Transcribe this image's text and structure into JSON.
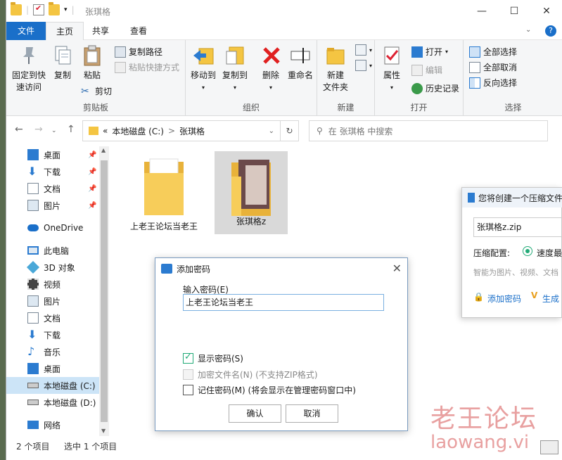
{
  "window": {
    "title": "张琪格",
    "minimize": "—",
    "maximize": "☐",
    "close": "✕"
  },
  "tabs": [
    "文件",
    "主页",
    "共享",
    "查看"
  ],
  "help_icon": "?",
  "ribbon": {
    "clipboard": {
      "pin_label": "固定到快速访问",
      "copy_label": "复制",
      "paste_label": "粘贴",
      "copy_path": "复制路径",
      "paste_shortcut": "粘贴快捷方式",
      "cut": "剪切",
      "group": "剪贴板"
    },
    "organize": {
      "move_to": "移动到",
      "copy_to": "复制到",
      "delete": "删除",
      "rename": "重命名",
      "group": "组织"
    },
    "new": {
      "new_folder": "新建\n文件夹",
      "group": "新建"
    },
    "open": {
      "properties": "属性",
      "open": "打开",
      "edit": "编辑",
      "history": "历史记录",
      "group": "打开"
    },
    "select": {
      "select_all": "全部选择",
      "select_none": "全部取消",
      "invert": "反向选择",
      "group": "选择"
    }
  },
  "address": {
    "prefix": "«",
    "drive": "本地磁盘 (C:)",
    "sep": ">",
    "folder": "张琪格",
    "search_placeholder": "在 张琪格 中搜索"
  },
  "nav": {
    "items": [
      {
        "label": "桌面",
        "pinned": true
      },
      {
        "label": "下载",
        "pinned": true
      },
      {
        "label": "文档",
        "pinned": true
      },
      {
        "label": "图片",
        "pinned": true
      },
      {
        "label": "OneDrive"
      },
      {
        "label": "此电脑"
      },
      {
        "label": "3D 对象"
      },
      {
        "label": "视频"
      },
      {
        "label": "图片"
      },
      {
        "label": "文档"
      },
      {
        "label": "下载"
      },
      {
        "label": "音乐"
      },
      {
        "label": "桌面"
      },
      {
        "label": "本地磁盘 (C:)"
      },
      {
        "label": "本地磁盘 (D:)"
      },
      {
        "label": "网络"
      }
    ]
  },
  "files": [
    {
      "name": "上老王论坛当老王"
    },
    {
      "name": "张琪格z"
    }
  ],
  "status": {
    "count": "2 个项目",
    "selected": "选中 1 个项目"
  },
  "password_dialog": {
    "title": "添加密码",
    "input_label": "输入密码(E)",
    "input_value": "上老王论坛当老王",
    "show_password": "显示密码(S)",
    "encrypt_names": "加密文件名(N) (不支持ZIP格式)",
    "remember": "记住密码(M) (将会显示在管理密码窗口中)",
    "ok": "确认",
    "cancel": "取消"
  },
  "zip_dialog": {
    "title": "您将创建一个压缩文件",
    "filename": "张琪格z.zip",
    "config_label": "压缩配置:",
    "speed": "速度最",
    "hint": "智能为图片、视频、文档",
    "add_password": "添加密码",
    "generate": "生成"
  },
  "watermark": {
    "line1": "老王论坛",
    "line2": "laowang.vi"
  }
}
